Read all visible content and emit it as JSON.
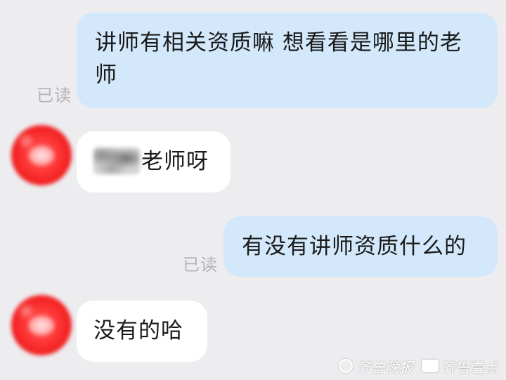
{
  "messages": [
    {
      "direction": "outgoing",
      "text": "讲师有相关资质嘛 想看看是哪里的老师",
      "status": "已读"
    },
    {
      "direction": "incoming",
      "text": "老师呀",
      "redacted_prefix": true
    },
    {
      "direction": "outgoing",
      "text": "有没有讲师资质什么的",
      "status": "已读"
    },
    {
      "direction": "incoming",
      "text": "没有的哈"
    }
  ],
  "watermark": {
    "publisher": "齐鲁晚报",
    "app": "齐鲁壹点"
  },
  "colors": {
    "background": "#ededf0",
    "outgoing_bubble": "#d3e9fb",
    "incoming_bubble": "#ffffff",
    "status_text": "#b4b4b8",
    "avatar": "#f01e1e"
  }
}
